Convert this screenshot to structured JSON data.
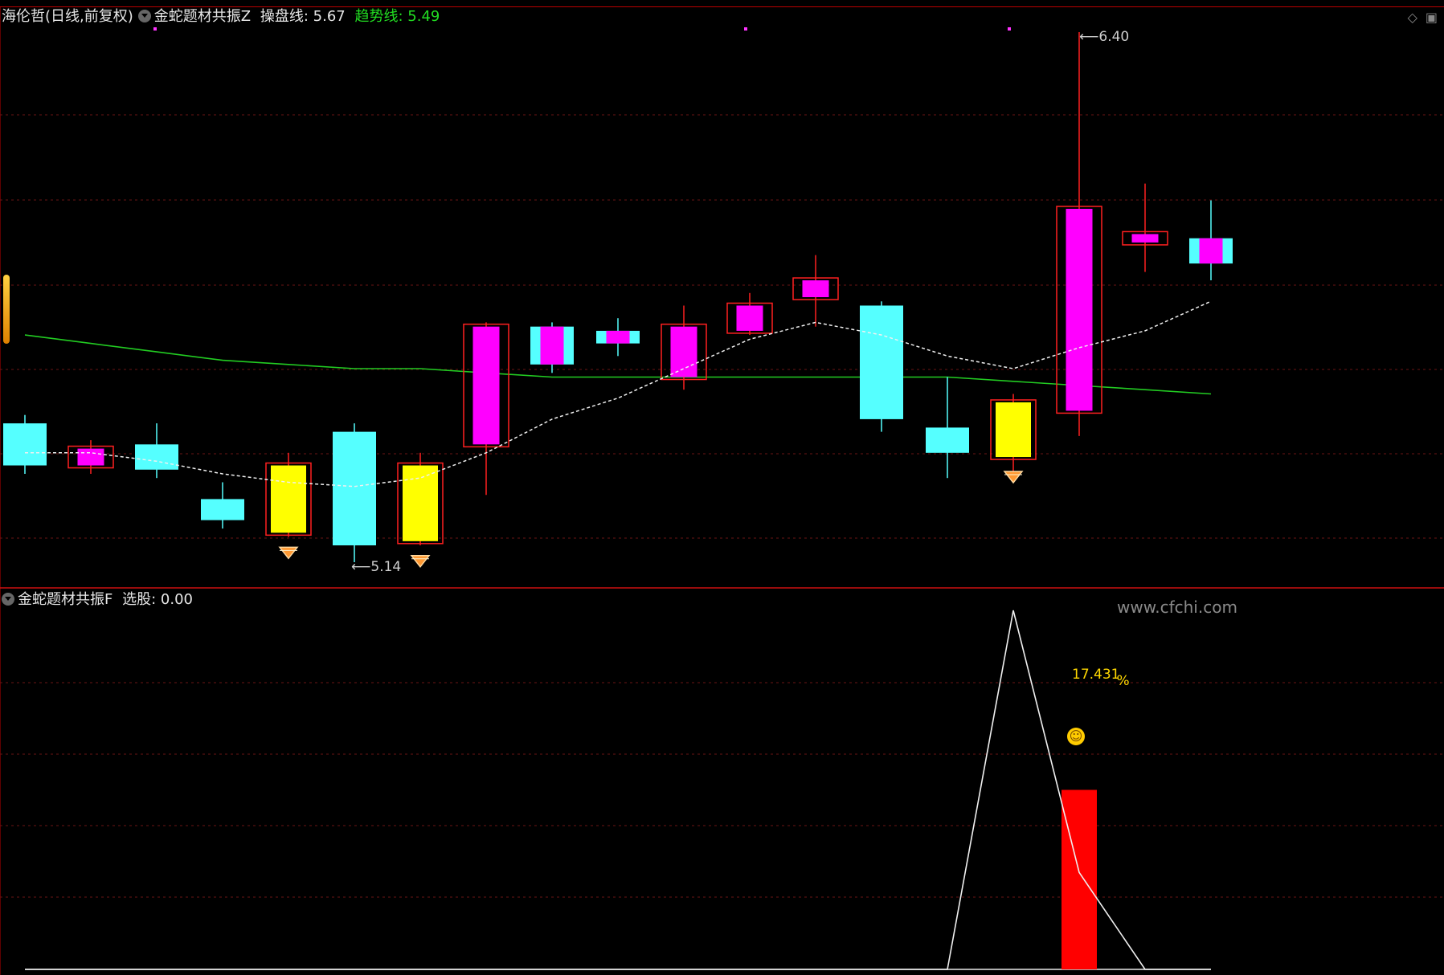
{
  "main_panel": {
    "stock_name": "海伦哲",
    "period_label": "(日线,前复权)",
    "indicator_name": "金蛇题材共振Z",
    "line1_label": "操盘线",
    "line1_value": "5.67",
    "line2_label": "趋势线",
    "line2_value": "5.49",
    "high_marker": "6.40",
    "low_marker": "5.14"
  },
  "sub_panel": {
    "indicator_name": "金蛇题材共振F",
    "value_label": "选股",
    "value": "0.00",
    "pct_label": "17.431",
    "pct_sign": "%"
  },
  "watermark": "www.cfchi.com",
  "colors": {
    "up": "#ff00ff",
    "down": "#55ffff",
    "signal": "#ffff00",
    "frame": "#ff2020",
    "trend": "#22cc22",
    "bar": "#ff0000"
  },
  "top_right_icons": [
    "diamond-icon",
    "window-icon"
  ],
  "chart_data": {
    "type": "candlestick",
    "price_range": [
      5.05,
      6.45
    ],
    "candles": [
      {
        "open": 5.47,
        "close": 5.37,
        "high": 5.49,
        "low": 5.35,
        "kind": "down"
      },
      {
        "open": 5.37,
        "close": 5.41,
        "high": 5.43,
        "low": 5.35,
        "kind": "up",
        "framed": true
      },
      {
        "open": 5.42,
        "close": 5.36,
        "high": 5.47,
        "low": 5.34,
        "kind": "down"
      },
      {
        "open": 5.29,
        "close": 5.24,
        "high": 5.33,
        "low": 5.22,
        "kind": "down"
      },
      {
        "open": 5.21,
        "close": 5.37,
        "high": 5.4,
        "low": 5.2,
        "kind": "signal",
        "framed": true,
        "diamond": true
      },
      {
        "open": 5.45,
        "close": 5.18,
        "high": 5.47,
        "low": 5.14,
        "kind": "down"
      },
      {
        "open": 5.19,
        "close": 5.37,
        "high": 5.4,
        "low": 5.18,
        "kind": "signal",
        "framed": true,
        "diamond": true
      },
      {
        "open": 5.42,
        "close": 5.7,
        "high": 5.71,
        "low": 5.3,
        "kind": "up",
        "framed": true
      },
      {
        "open": 5.61,
        "close": 5.7,
        "high": 5.71,
        "low": 5.59,
        "kind": "mixed"
      },
      {
        "open": 5.66,
        "close": 5.69,
        "high": 5.72,
        "low": 5.63,
        "kind": "mixed"
      },
      {
        "open": 5.58,
        "close": 5.7,
        "high": 5.75,
        "low": 5.55,
        "kind": "up",
        "framed": true
      },
      {
        "open": 5.69,
        "close": 5.75,
        "high": 5.78,
        "low": 5.68,
        "kind": "up",
        "framed": true
      },
      {
        "open": 5.77,
        "close": 5.81,
        "high": 5.87,
        "low": 5.7,
        "kind": "up",
        "framed": true
      },
      {
        "open": 5.75,
        "close": 5.48,
        "high": 5.76,
        "low": 5.45,
        "kind": "down"
      },
      {
        "open": 5.46,
        "close": 5.4,
        "high": 5.58,
        "low": 5.34,
        "kind": "down"
      },
      {
        "open": 5.52,
        "close": 5.39,
        "high": 5.54,
        "low": 5.34,
        "kind": "signal",
        "framed": true,
        "diamond": true
      },
      {
        "open": 5.5,
        "close": 5.98,
        "high": 6.4,
        "low": 5.44,
        "kind": "up",
        "framed": true
      },
      {
        "open": 5.92,
        "close": 5.9,
        "high": 6.04,
        "low": 5.83,
        "kind": "up",
        "framed": true
      },
      {
        "open": 5.85,
        "close": 5.91,
        "high": 6.0,
        "low": 5.81,
        "kind": "mixed"
      }
    ],
    "line1_dashed": [
      5.4,
      5.4,
      5.38,
      5.35,
      5.33,
      5.32,
      5.34,
      5.4,
      5.48,
      5.53,
      5.6,
      5.67,
      5.71,
      5.68,
      5.63,
      5.6,
      5.65,
      5.69,
      5.76
    ],
    "line2_trend": [
      5.68,
      5.66,
      5.64,
      5.62,
      5.61,
      5.6,
      5.6,
      5.59,
      5.58,
      5.58,
      5.58,
      5.58,
      5.58,
      5.58,
      5.58,
      5.57,
      5.56,
      5.55,
      5.54
    ],
    "sub_range": [
      0,
      100
    ],
    "sub_line": [
      0,
      0,
      0,
      0,
      0,
      0,
      0,
      0,
      0,
      0,
      0,
      0,
      0,
      0,
      0,
      100,
      27,
      0,
      0
    ],
    "sub_bar_index": 16,
    "sub_bar_value": 50
  }
}
